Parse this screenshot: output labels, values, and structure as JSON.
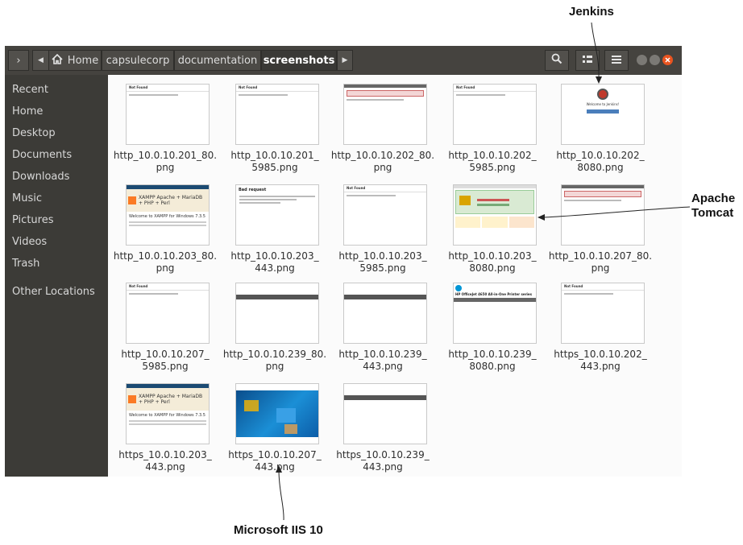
{
  "annotations": {
    "jenkins": "Jenkins",
    "apache": "Apache",
    "tomcat": "Tomcat",
    "iis": "Microsoft IIS 10"
  },
  "toolbar": {
    "home_label": "Home"
  },
  "breadcrumbs": [
    {
      "label": "capsulecorp"
    },
    {
      "label": "documentation"
    },
    {
      "label": "screenshots",
      "active": true
    }
  ],
  "sidebar": {
    "items": [
      {
        "label": "Recent"
      },
      {
        "label": "Home"
      },
      {
        "label": "Desktop"
      },
      {
        "label": "Documents"
      },
      {
        "label": "Downloads"
      },
      {
        "label": "Music"
      },
      {
        "label": "Pictures"
      },
      {
        "label": "Videos"
      },
      {
        "label": "Trash"
      },
      {
        "label": "Other Locations"
      }
    ]
  },
  "files": [
    {
      "line1": "http_10.0.10.201_80.",
      "line2": "png",
      "thumb": "notfound"
    },
    {
      "line1": "http_10.0.10.201_",
      "line2": "5985.png",
      "thumb": "notfound"
    },
    {
      "line1": "http_10.0.10.202_80.",
      "line2": "png",
      "thumb": "iiserror"
    },
    {
      "line1": "http_10.0.10.202_",
      "line2": "5985.png",
      "thumb": "notfound"
    },
    {
      "line1": "http_10.0.10.202_",
      "line2": "8080.png",
      "thumb": "jenkins"
    },
    {
      "line1": "http_10.0.10.203_80.",
      "line2": "png",
      "thumb": "xampp"
    },
    {
      "line1": "http_10.0.10.203_",
      "line2": "443.png",
      "thumb": "badrequest"
    },
    {
      "line1": "http_10.0.10.203_",
      "line2": "5985.png",
      "thumb": "notfound"
    },
    {
      "line1": "http_10.0.10.203_",
      "line2": "8080.png",
      "thumb": "tomcat"
    },
    {
      "line1": "http_10.0.10.207_80.",
      "line2": "png",
      "thumb": "iiserror"
    },
    {
      "line1": "http_10.0.10.207_",
      "line2": "5985.png",
      "thumb": "notfound"
    },
    {
      "line1": "http_10.0.10.239_80.",
      "line2": "png",
      "thumb": "darkbar"
    },
    {
      "line1": "http_10.0.10.239_",
      "line2": "443.png",
      "thumb": "darkbar"
    },
    {
      "line1": "http_10.0.10.239_",
      "line2": "8080.png",
      "thumb": "hpprinter"
    },
    {
      "line1": "https_10.0.10.202_",
      "line2": "443.png",
      "thumb": "notfound"
    },
    {
      "line1": "https_10.0.10.203_",
      "line2": "443.png",
      "thumb": "xampp"
    },
    {
      "line1": "https_10.0.10.207_",
      "line2": "443.png",
      "thumb": "iis10"
    },
    {
      "line1": "https_10.0.10.239_",
      "line2": "443.png",
      "thumb": "darkbar"
    }
  ],
  "thumb_text": {
    "not_found": "Not Found",
    "xampp_title": "XAMPP Apache + MariaDB + PHP + Perl",
    "xampp_welcome": "Welcome to XAMPP for Windows 7.3.5",
    "bad_request": "Bad request",
    "hp_title": "HP OfficeJet 4650 All-in-One Printer series",
    "jenkins_welcome": "Welcome to Jenkins!"
  },
  "colors": {
    "header": "#45433f",
    "sidebar": "#3c3b37",
    "close": "#e95420"
  }
}
